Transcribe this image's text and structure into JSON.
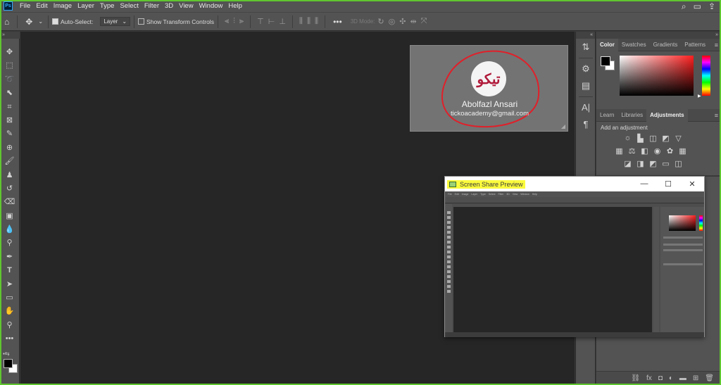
{
  "app": {
    "logo_text": "Ps"
  },
  "menu": [
    "File",
    "Edit",
    "Image",
    "Layer",
    "Type",
    "Select",
    "Filter",
    "3D",
    "View",
    "Window",
    "Help"
  ],
  "menu_right_icons": [
    "search-icon",
    "workspace-icon",
    "share-icon"
  ],
  "options_bar": {
    "auto_select_label": "Auto-Select:",
    "auto_select_checked": true,
    "target_value": "Layer",
    "transform_controls_label": "Show Transform Controls",
    "transform_controls_checked": false,
    "mode_3d_label": "3D Mode:"
  },
  "watermark": {
    "name": "Abolfazl Ansari",
    "email": "tickoacademy@gmail.com",
    "logo_glyph": "تیکو",
    "annotation_color": "#e0202a"
  },
  "right_panel": {
    "color_tabs": [
      "Color",
      "Swatches",
      "Gradients",
      "Patterns"
    ],
    "active_color_tab": "Color",
    "adjust_tabs": [
      "Learn",
      "Libraries",
      "Adjustments"
    ],
    "active_adjust_tab": "Adjustments",
    "add_adjustment_label": "Add an adjustment"
  },
  "share_window": {
    "title": "Screen Share Preview",
    "minimize_glyph": "—",
    "maximize_glyph": "☐",
    "close_glyph": "✕"
  },
  "colors": {
    "foreground": "#000000",
    "background": "#ffffff",
    "highlight": "#fbfb3c",
    "border": "#5fc62f"
  }
}
